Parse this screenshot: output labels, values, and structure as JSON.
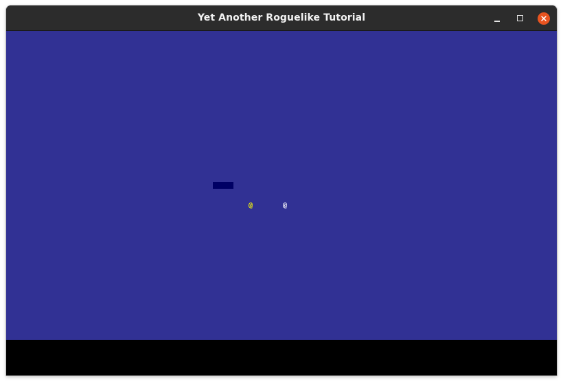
{
  "window": {
    "title": "Yet Another Roguelike Tutorial",
    "controls": {
      "minimize": "minimize-icon",
      "maximize": "maximize-icon",
      "close": "close-icon"
    }
  },
  "colors": {
    "floor": "#313194",
    "wall": "#000064",
    "npc": "#ffff00",
    "player": "#ffffff",
    "close_button": "#e95420"
  },
  "game": {
    "npc_glyph": "@",
    "player_glyph": "@"
  }
}
